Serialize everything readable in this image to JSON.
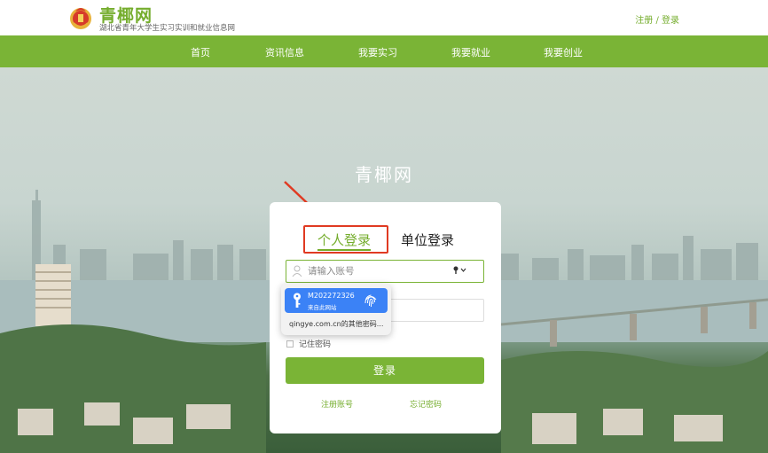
{
  "header": {
    "site_title": "青椰网",
    "site_subtitle": "湖北省青年大学生实习实训和就业信息网",
    "auth_link": "注册 / 登录"
  },
  "nav": {
    "items": [
      "首页",
      "资讯信息",
      "我要实习",
      "我要就业",
      "我要创业"
    ]
  },
  "hero": {
    "title": "青椰网"
  },
  "login": {
    "tab_personal": "个人登录",
    "tab_company": "单位登录",
    "account_placeholder": "请输入账号",
    "remember_label": "记住密码",
    "submit_label": "登录",
    "register_link": "注册账号",
    "forgot_link": "忘记密码"
  },
  "autofill": {
    "account": "M202272326",
    "source": "来自此网站",
    "other_passwords": "qingye.com.cn的其他密码..."
  },
  "colors": {
    "brand_green": "#7ab436",
    "highlight_red": "#e03a22",
    "autofill_blue": "#3b82f6"
  }
}
